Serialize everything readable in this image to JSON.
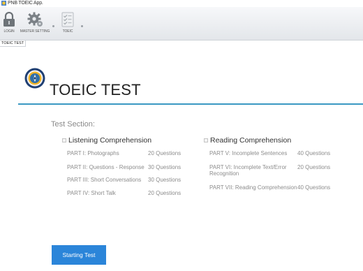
{
  "window": {
    "title": "PNB TOEIC App."
  },
  "ribbon": {
    "buttons": [
      {
        "label": "LOGIN",
        "icon": "lock-icon"
      },
      {
        "label": "MASTER SETTING",
        "icon": "gear-icon"
      },
      {
        "label": "TOEIC",
        "icon": "checklist-icon"
      }
    ]
  },
  "tabs": [
    {
      "label": "TOEIC TEST"
    }
  ],
  "page": {
    "title": "TOEIC TEST",
    "logo_icon": "seal-logo-icon",
    "accent_color": "#3b98c2",
    "section_label": "Test Section:"
  },
  "groups": {
    "listening": {
      "label": "Listening Comprehension",
      "parts": [
        {
          "name": "PART I: Photographs",
          "questions": "20 Questions"
        },
        {
          "name": "PART II: Questions - Response",
          "questions": "30 Questions"
        },
        {
          "name": "PART III: Short Conversations",
          "questions": "30 Questions"
        },
        {
          "name": "PART IV: Short Talk",
          "questions": "20 Questions"
        }
      ]
    },
    "reading": {
      "label": "Reading Comprehension",
      "parts": [
        {
          "name": "PART V: Incomplete Sentences",
          "questions": "40 Questions"
        },
        {
          "name": "PART VI: Incomplete Text/Error Recognition",
          "questions": "20 Questions"
        },
        {
          "name": "PART VII: Reading Comprehension",
          "questions": "40 Questions"
        }
      ]
    }
  },
  "actions": {
    "start_label": "Starting Test",
    "start_color": "#2b85d9"
  }
}
